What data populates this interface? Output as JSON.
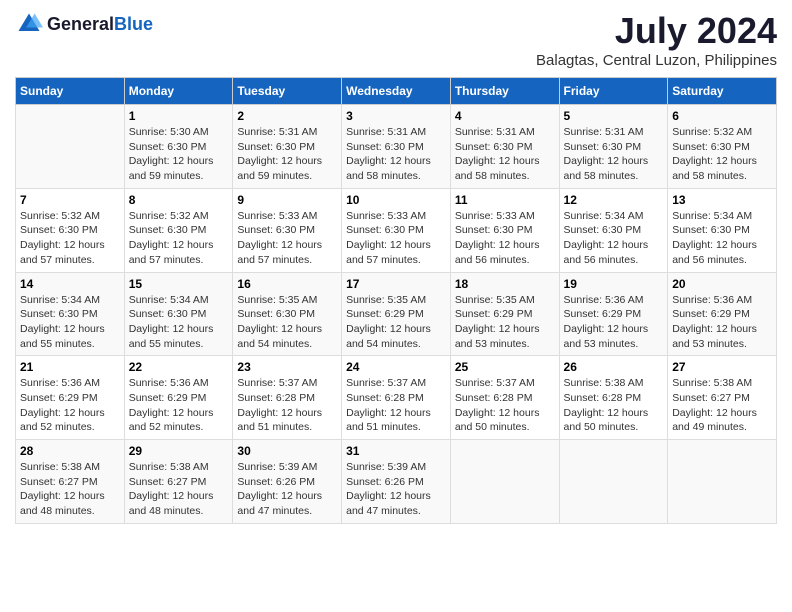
{
  "logo": {
    "general": "General",
    "blue": "Blue"
  },
  "title": "July 2024",
  "subtitle": "Balagtas, Central Luzon, Philippines",
  "days_of_week": [
    "Sunday",
    "Monday",
    "Tuesday",
    "Wednesday",
    "Thursday",
    "Friday",
    "Saturday"
  ],
  "weeks": [
    [
      {
        "day": "",
        "info": ""
      },
      {
        "day": "1",
        "info": "Sunrise: 5:30 AM\nSunset: 6:30 PM\nDaylight: 12 hours\nand 59 minutes."
      },
      {
        "day": "2",
        "info": "Sunrise: 5:31 AM\nSunset: 6:30 PM\nDaylight: 12 hours\nand 59 minutes."
      },
      {
        "day": "3",
        "info": "Sunrise: 5:31 AM\nSunset: 6:30 PM\nDaylight: 12 hours\nand 58 minutes."
      },
      {
        "day": "4",
        "info": "Sunrise: 5:31 AM\nSunset: 6:30 PM\nDaylight: 12 hours\nand 58 minutes."
      },
      {
        "day": "5",
        "info": "Sunrise: 5:31 AM\nSunset: 6:30 PM\nDaylight: 12 hours\nand 58 minutes."
      },
      {
        "day": "6",
        "info": "Sunrise: 5:32 AM\nSunset: 6:30 PM\nDaylight: 12 hours\nand 58 minutes."
      }
    ],
    [
      {
        "day": "7",
        "info": "Sunrise: 5:32 AM\nSunset: 6:30 PM\nDaylight: 12 hours\nand 57 minutes."
      },
      {
        "day": "8",
        "info": "Sunrise: 5:32 AM\nSunset: 6:30 PM\nDaylight: 12 hours\nand 57 minutes."
      },
      {
        "day": "9",
        "info": "Sunrise: 5:33 AM\nSunset: 6:30 PM\nDaylight: 12 hours\nand 57 minutes."
      },
      {
        "day": "10",
        "info": "Sunrise: 5:33 AM\nSunset: 6:30 PM\nDaylight: 12 hours\nand 57 minutes."
      },
      {
        "day": "11",
        "info": "Sunrise: 5:33 AM\nSunset: 6:30 PM\nDaylight: 12 hours\nand 56 minutes."
      },
      {
        "day": "12",
        "info": "Sunrise: 5:34 AM\nSunset: 6:30 PM\nDaylight: 12 hours\nand 56 minutes."
      },
      {
        "day": "13",
        "info": "Sunrise: 5:34 AM\nSunset: 6:30 PM\nDaylight: 12 hours\nand 56 minutes."
      }
    ],
    [
      {
        "day": "14",
        "info": "Sunrise: 5:34 AM\nSunset: 6:30 PM\nDaylight: 12 hours\nand 55 minutes."
      },
      {
        "day": "15",
        "info": "Sunrise: 5:34 AM\nSunset: 6:30 PM\nDaylight: 12 hours\nand 55 minutes."
      },
      {
        "day": "16",
        "info": "Sunrise: 5:35 AM\nSunset: 6:30 PM\nDaylight: 12 hours\nand 54 minutes."
      },
      {
        "day": "17",
        "info": "Sunrise: 5:35 AM\nSunset: 6:29 PM\nDaylight: 12 hours\nand 54 minutes."
      },
      {
        "day": "18",
        "info": "Sunrise: 5:35 AM\nSunset: 6:29 PM\nDaylight: 12 hours\nand 53 minutes."
      },
      {
        "day": "19",
        "info": "Sunrise: 5:36 AM\nSunset: 6:29 PM\nDaylight: 12 hours\nand 53 minutes."
      },
      {
        "day": "20",
        "info": "Sunrise: 5:36 AM\nSunset: 6:29 PM\nDaylight: 12 hours\nand 53 minutes."
      }
    ],
    [
      {
        "day": "21",
        "info": "Sunrise: 5:36 AM\nSunset: 6:29 PM\nDaylight: 12 hours\nand 52 minutes."
      },
      {
        "day": "22",
        "info": "Sunrise: 5:36 AM\nSunset: 6:29 PM\nDaylight: 12 hours\nand 52 minutes."
      },
      {
        "day": "23",
        "info": "Sunrise: 5:37 AM\nSunset: 6:28 PM\nDaylight: 12 hours\nand 51 minutes."
      },
      {
        "day": "24",
        "info": "Sunrise: 5:37 AM\nSunset: 6:28 PM\nDaylight: 12 hours\nand 51 minutes."
      },
      {
        "day": "25",
        "info": "Sunrise: 5:37 AM\nSunset: 6:28 PM\nDaylight: 12 hours\nand 50 minutes."
      },
      {
        "day": "26",
        "info": "Sunrise: 5:38 AM\nSunset: 6:28 PM\nDaylight: 12 hours\nand 50 minutes."
      },
      {
        "day": "27",
        "info": "Sunrise: 5:38 AM\nSunset: 6:27 PM\nDaylight: 12 hours\nand 49 minutes."
      }
    ],
    [
      {
        "day": "28",
        "info": "Sunrise: 5:38 AM\nSunset: 6:27 PM\nDaylight: 12 hours\nand 48 minutes."
      },
      {
        "day": "29",
        "info": "Sunrise: 5:38 AM\nSunset: 6:27 PM\nDaylight: 12 hours\nand 48 minutes."
      },
      {
        "day": "30",
        "info": "Sunrise: 5:39 AM\nSunset: 6:26 PM\nDaylight: 12 hours\nand 47 minutes."
      },
      {
        "day": "31",
        "info": "Sunrise: 5:39 AM\nSunset: 6:26 PM\nDaylight: 12 hours\nand 47 minutes."
      },
      {
        "day": "",
        "info": ""
      },
      {
        "day": "",
        "info": ""
      },
      {
        "day": "",
        "info": ""
      }
    ]
  ]
}
